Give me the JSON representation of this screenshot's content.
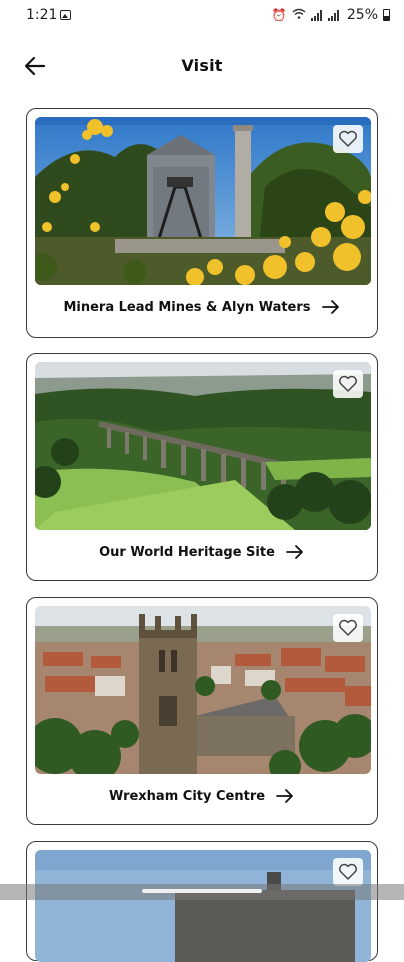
{
  "status_bar": {
    "time": "1:21",
    "battery": "25%"
  },
  "header": {
    "title": "Visit"
  },
  "cards": [
    {
      "title": "Minera Lead Mines & Alyn Waters",
      "image": "mine-engine-house-photo"
    },
    {
      "title": "Our World Heritage Site",
      "image": "aqueduct-valley-photo"
    },
    {
      "title": "Wrexham City Centre",
      "image": "church-tower-town-photo"
    },
    {
      "title": "",
      "image": "building-sky-photo"
    }
  ],
  "icons": {
    "back": "arrow-left-icon",
    "favorite": "heart-outline-icon",
    "caption_arrow": "arrow-right-icon"
  },
  "colors": {
    "text": "#111111",
    "card_border": "#3a3a3a",
    "background": "#ffffff"
  }
}
